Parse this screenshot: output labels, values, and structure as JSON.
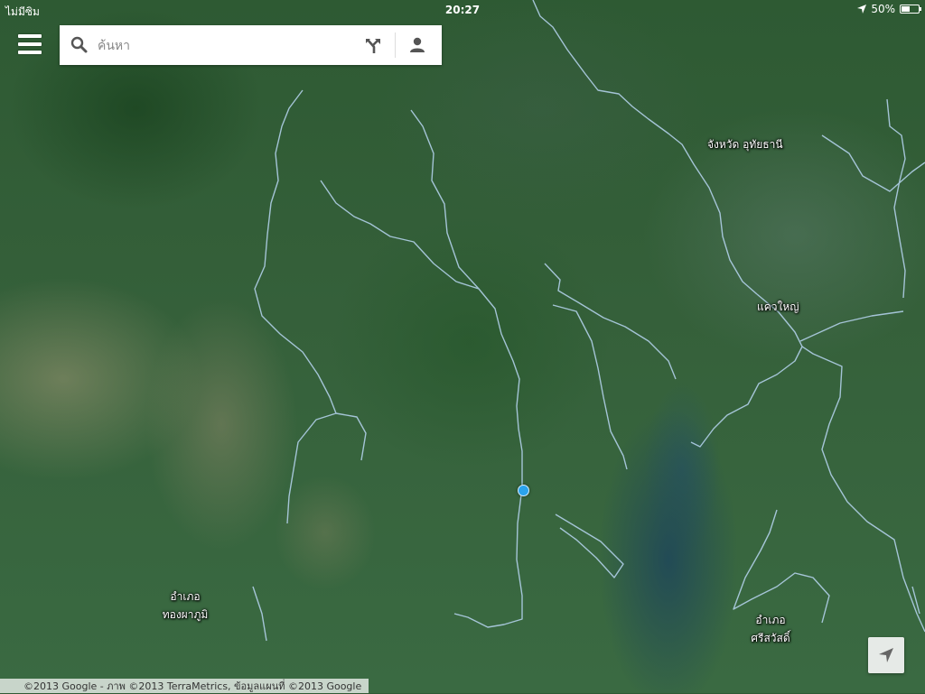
{
  "status_bar": {
    "carrier": "ไม่มีซิม",
    "time": "20:27",
    "battery": "50%",
    "battery_level": 0.5
  },
  "search": {
    "placeholder": "ค้นหา",
    "value": ""
  },
  "icons": {
    "menu": "menu-icon",
    "search": "search-icon",
    "directions": "directions-icon",
    "account": "account-icon",
    "location_arrow": "location-arrow-icon"
  },
  "map": {
    "view": "satellite",
    "labels": [
      {
        "id": "chang-wat-uthai-thani",
        "text": "จังหวัด อุทัยธานี"
      },
      {
        "id": "khaw-yai",
        "text": "แควใหญ่"
      },
      {
        "id": "amphoe-thong-pha-phum",
        "line1": "อำเภอ",
        "line2": "ทองผาภูมิ"
      },
      {
        "id": "amphoe-si-sawat",
        "line1": "อำเภอ",
        "line2": "ศรีสวัสดิ์"
      }
    ],
    "attribution": "©2013 Google - ภาพ ©2013 TerraMetrics, ข้อมูลแผนที่ ©2013 Google"
  },
  "colors": {
    "river": "#b8d6f2",
    "my_location": "#2aa3ec",
    "search_box_bg": "#ffffff"
  }
}
